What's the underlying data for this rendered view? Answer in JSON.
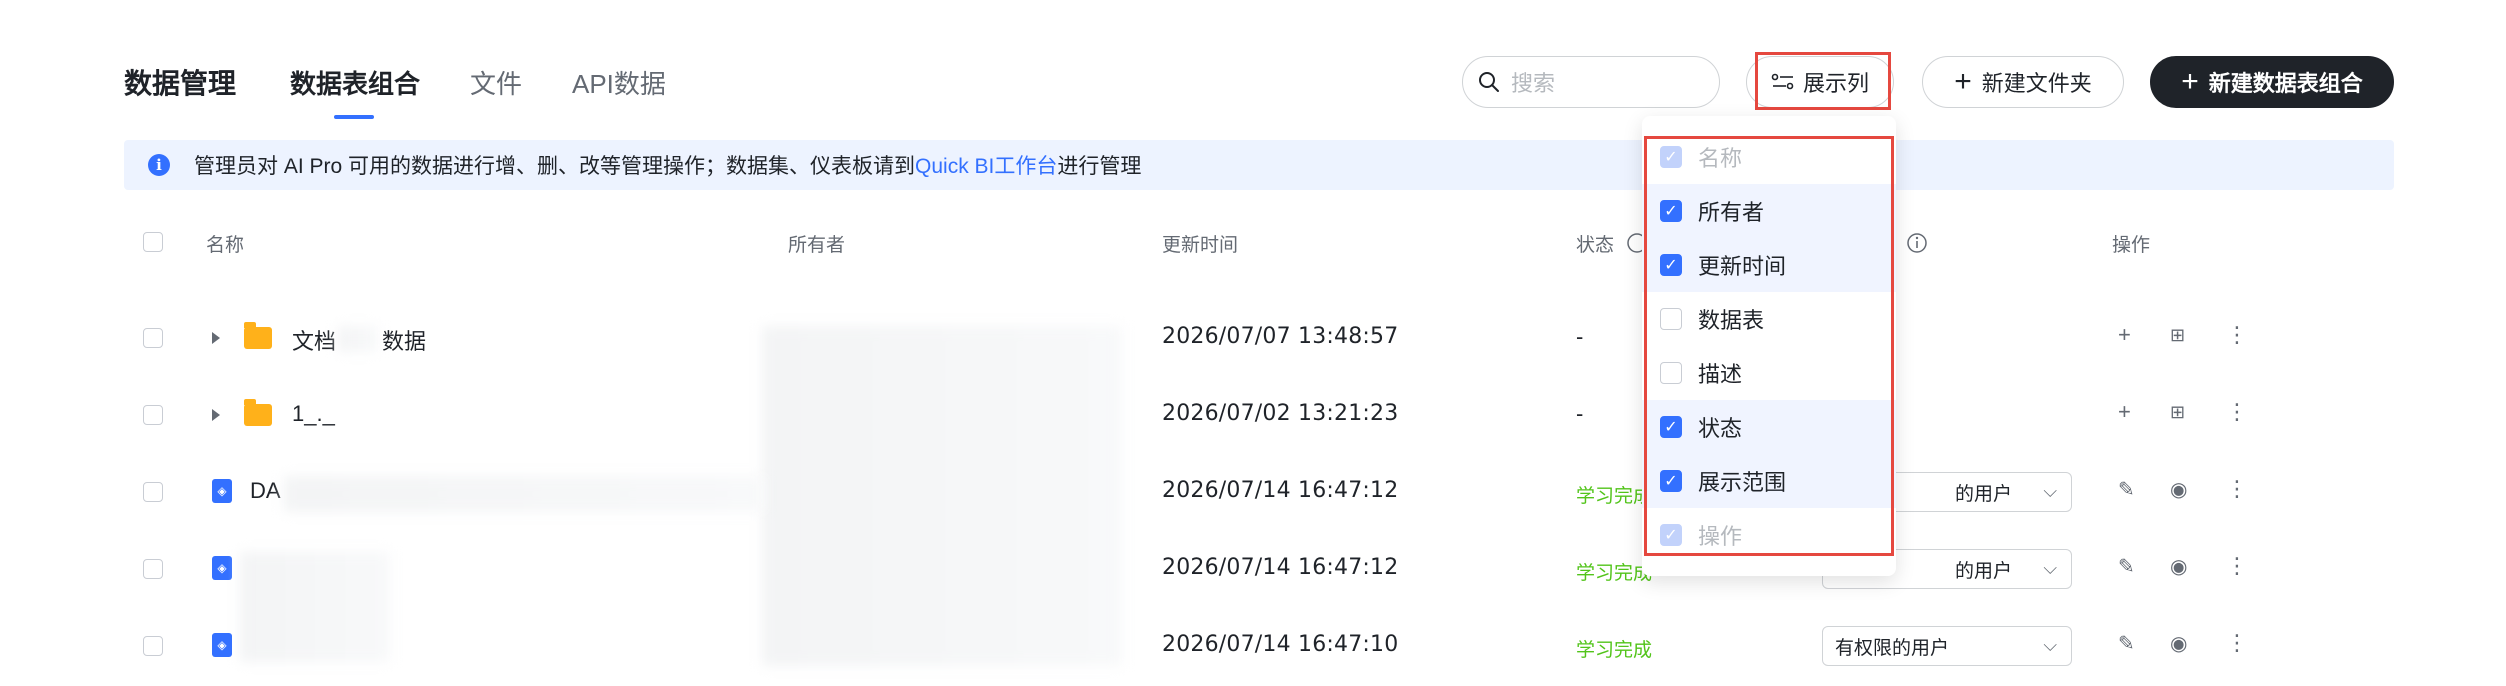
{
  "header": {
    "title": "数据管理",
    "tabs": [
      {
        "label": "数据表组合",
        "active": true
      },
      {
        "label": "文件",
        "active": false
      },
      {
        "label": "API数据",
        "active": false
      }
    ],
    "search_placeholder": "搜索",
    "columns_button": "展示列",
    "new_folder_button": "新建文件夹",
    "new_combo_button": "新建数据表组合"
  },
  "notice": {
    "text": "管理员对 AI Pro 可用的数据进行增、删、改等管理操作；数据集、仪表板请到",
    "link": "Quick BI工作台",
    "suffix": "进行管理"
  },
  "table": {
    "columns": [
      "名称",
      "所有者",
      "更新时间",
      "状态",
      "操作"
    ],
    "rows": [
      {
        "type": "folder",
        "name_a": "文档",
        "name_b": "数据",
        "updated": "2026/07/07 13:48:57",
        "status": "-"
      },
      {
        "type": "folder",
        "name_a": "1_._",
        "name_b": "",
        "updated": "2026/07/02 13:21:23",
        "status": "-"
      },
      {
        "type": "table",
        "name_a": "DA",
        "name_b": "",
        "updated": "2026/07/14 16:47:12",
        "status": "学习完成",
        "scope": "的用户"
      },
      {
        "type": "table",
        "name_a": "",
        "name_b": "",
        "updated": "2026/07/14 16:47:12",
        "status": "学习完成",
        "scope": "的用户"
      },
      {
        "type": "table",
        "name_a": "",
        "name_b": "",
        "updated": "2026/07/14 16:47:10",
        "status": "学习完成",
        "scope": "有权限的用户"
      }
    ]
  },
  "column_menu": {
    "items": [
      {
        "label": "名称",
        "checked": true,
        "disabled": true
      },
      {
        "label": "所有者",
        "checked": true,
        "disabled": false
      },
      {
        "label": "更新时间",
        "checked": true,
        "disabled": false
      },
      {
        "label": "数据表",
        "checked": false,
        "disabled": false
      },
      {
        "label": "描述",
        "checked": false,
        "disabled": false
      },
      {
        "label": "状态",
        "checked": true,
        "disabled": false
      },
      {
        "label": "展示范围",
        "checked": true,
        "disabled": false
      },
      {
        "label": "操作",
        "checked": true,
        "disabled": true
      }
    ]
  },
  "colors": {
    "accent": "#3370ff",
    "success": "#52c41a",
    "highlight": "#e5483f",
    "primary_button": "#1f2329"
  }
}
